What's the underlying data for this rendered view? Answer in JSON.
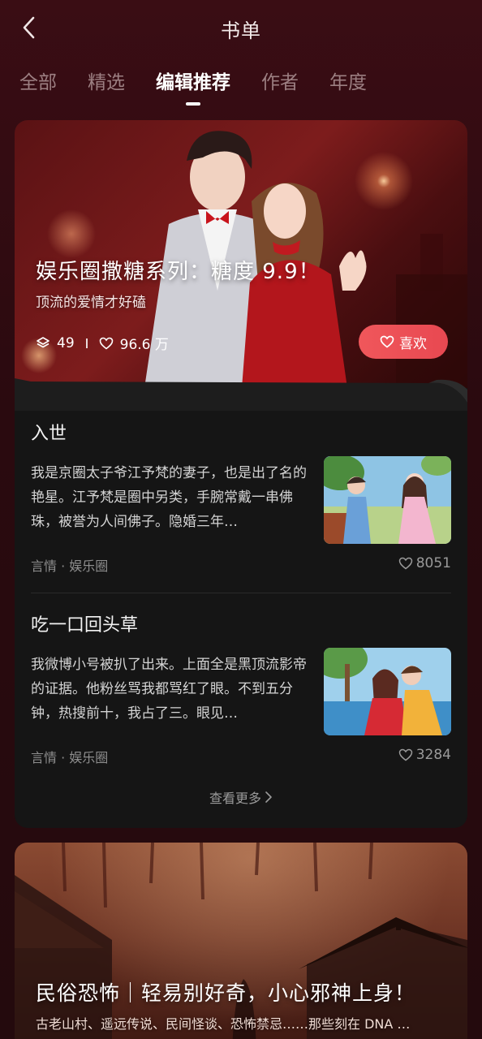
{
  "header": {
    "title": "书单"
  },
  "tabs": [
    {
      "label": "全部",
      "active": false
    },
    {
      "label": "精选",
      "active": false
    },
    {
      "label": "编辑推荐",
      "active": true
    },
    {
      "label": "作者",
      "active": false
    },
    {
      "label": "年度",
      "active": false
    }
  ],
  "card1": {
    "title": "娱乐圈撒糖系列：糖度 9.9！",
    "subtitle": "顶流的爱情才好磕",
    "book_count": "49",
    "likes": "96.6 万",
    "like_button": "喜欢",
    "books": [
      {
        "title": "入世",
        "desc": "我是京圈太子爷江予梵的妻子，也是出了名的艳星。江予梵是圈中另类，手腕常戴一串佛珠，被誉为人间佛子。隐婚三年…",
        "meta": "言情 · 娱乐圈",
        "likes": "8051"
      },
      {
        "title": "吃一口回头草",
        "desc": "我微博小号被扒了出来。上面全是黑顶流影帝的证据。他粉丝骂我都骂红了眼。不到五分钟，热搜前十，我占了三。眼见…",
        "meta": "言情 · 娱乐圈",
        "likes": "3284"
      }
    ],
    "more_label": "查看更多"
  },
  "card2": {
    "title": "民俗恐怖｜轻易别好奇，小心邪神上身！",
    "subtitle": "古老山村、遥远传说、民间怪谈、恐怖禁忌……那些刻在 DNA …"
  },
  "colors": {
    "accent": "#e84851",
    "background": "#2a0a0f",
    "card": "#151515"
  }
}
